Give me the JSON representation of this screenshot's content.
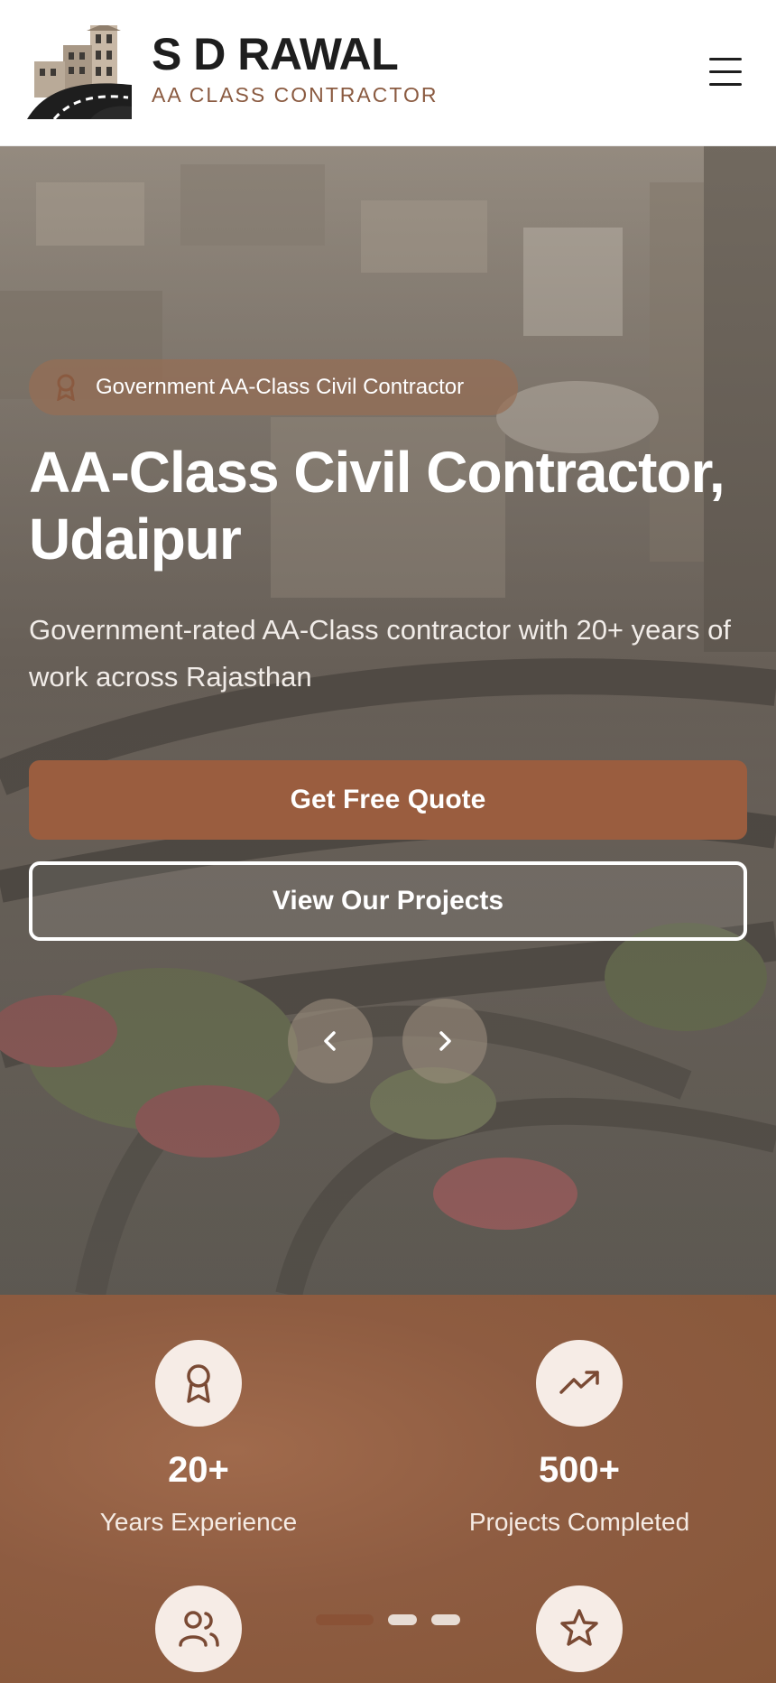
{
  "header": {
    "brand_name": "S D RAWAL",
    "brand_tagline": "AA CLASS CONTRACTOR",
    "logo_icon": "building-road-logo",
    "menu_icon": "hamburger-menu-icon"
  },
  "hero": {
    "badge_text": "Government AA-Class Civil Contractor",
    "title": "AA-Class Civil Contractor, Udaipur",
    "subtitle": "Government-rated AA-Class contractor with 20+ years of work across Rajasthan",
    "primary_button": "Get Free Quote",
    "secondary_button": "View Our Projects",
    "prev_icon": "chevron-left-icon",
    "next_icon": "chevron-right-icon"
  },
  "stats": [
    {
      "value": "20+",
      "label": "Years Experience",
      "icon": "award-icon"
    },
    {
      "value": "500+",
      "label": "Projects Completed",
      "icon": "trending-up-icon"
    },
    {
      "value": "",
      "label": "",
      "icon": "users-icon"
    },
    {
      "value": "",
      "label": "",
      "icon": "star-icon"
    }
  ],
  "carousel": {
    "slide_count": 3,
    "active_index": 0
  },
  "colors": {
    "brand_brown": "#9a5d3f",
    "tagline_brown": "#8a5a40",
    "stat_bg": "#8e5c41",
    "icon_circle": "#f6ece6",
    "dark_text": "#1e1e1e"
  }
}
